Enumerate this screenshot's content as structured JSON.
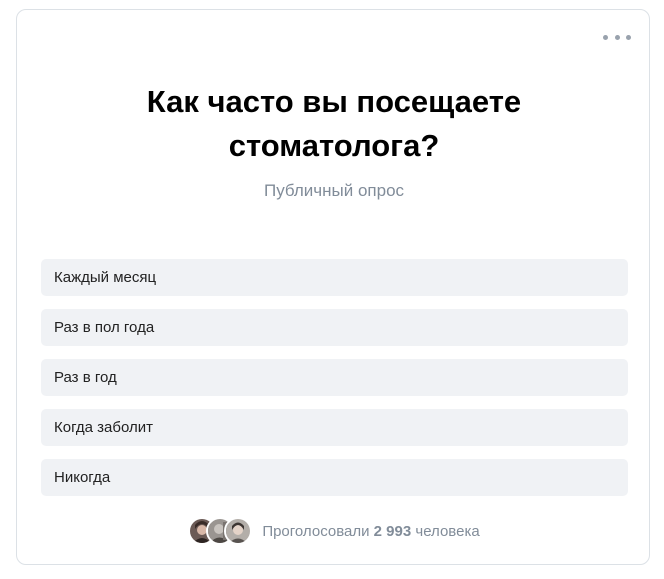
{
  "poll": {
    "title_line1": "Как часто вы посещаете",
    "title_line2": "стоматолога?",
    "subtitle": "Публичный опрос",
    "options": [
      {
        "label": "Каждый месяц"
      },
      {
        "label": "Раз в пол года"
      },
      {
        "label": "Раз в год"
      },
      {
        "label": "Когда заболит"
      },
      {
        "label": "Никогда"
      }
    ],
    "footer": {
      "prefix": "Проголосовали",
      "count": "2 993",
      "suffix": "человека"
    }
  },
  "icons": {
    "menu": "more-horizontal-icon"
  }
}
